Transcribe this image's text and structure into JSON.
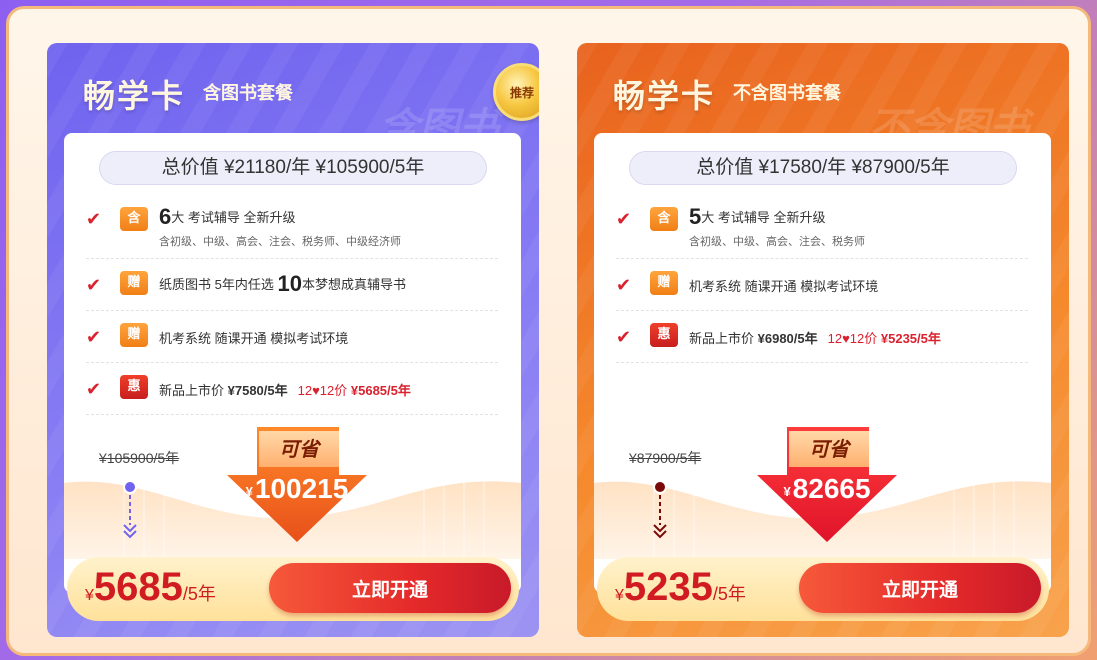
{
  "cards": [
    {
      "title": "畅学卡",
      "subtitle": "含图书套餐",
      "watermark": "含图书",
      "badge": "推荐",
      "total": "总价值 ¥21180/年 ¥105900/5年",
      "features": {
        "f1_tag": "含",
        "f1_num": "6",
        "f1_text": "大 考试辅导 全新升级",
        "f1_sub": "含初级、中级、高会、注会、税务师、中级经济师",
        "f2_tag": "赠",
        "f2_pre": "纸质图书 5年内任选 ",
        "f2_num": "10",
        "f2_post": "本梦想成真辅导书",
        "f3_tag": "赠",
        "f3_text": "机考系统 随课开通 模拟考试环境",
        "f4_tag": "惠",
        "f4_pre": "新品上市价 ",
        "f4_price": "¥7580/5年",
        "f4_promo_pre": "12♥12价 ",
        "f4_promo_price": "¥5685/5年"
      },
      "old_price": "¥105900/5年",
      "save_label": "可省",
      "save_yen": "¥",
      "save_amount": "100215",
      "price_yen": "¥",
      "price": "5685",
      "price_unit": "/5年",
      "button": "立即开通"
    },
    {
      "title": "畅学卡",
      "subtitle": "不含图书套餐",
      "watermark": "不含图书",
      "total": "总价值 ¥17580/年 ¥87900/5年",
      "features": {
        "f1_tag": "含",
        "f1_num": "5",
        "f1_text": "大 考试辅导 全新升级",
        "f1_sub": "含初级、中级、高会、注会、税务师",
        "f2_tag": "赠",
        "f2_text": "机考系统 随课开通 模拟考试环境",
        "f3_tag": "惠",
        "f3_pre": "新品上市价 ",
        "f3_price": "¥6980/5年",
        "f3_promo_pre": "12♥12价 ",
        "f3_promo_price": "¥5235/5年"
      },
      "old_price": "¥87900/5年",
      "save_label": "可省",
      "save_yen": "¥",
      "save_amount": "82665",
      "price_yen": "¥",
      "price": "5235",
      "price_unit": "/5年",
      "button": "立即开通"
    }
  ],
  "colors": {
    "left_card": "#6f63ef",
    "right_card": "#e8621e",
    "check": "#d9222e",
    "price": "#d01b22",
    "button": "#e42a2a"
  }
}
